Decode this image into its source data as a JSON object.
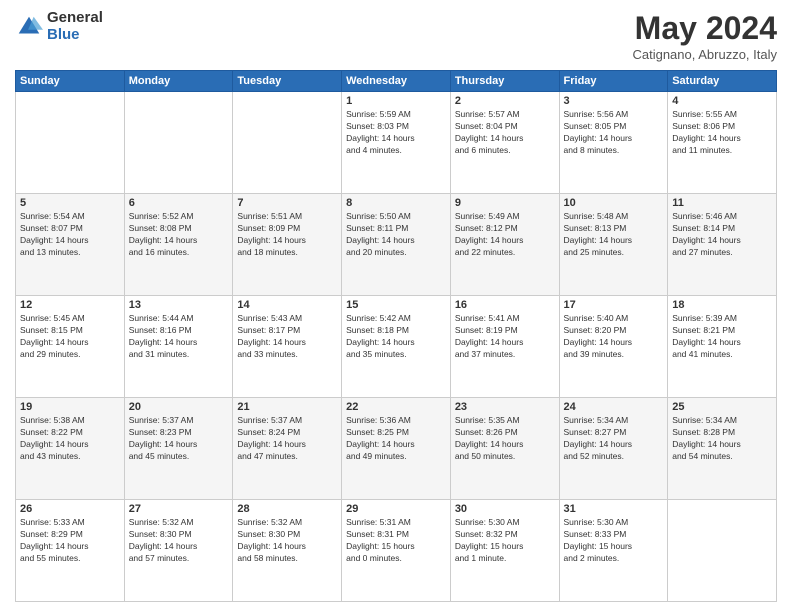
{
  "logo": {
    "general": "General",
    "blue": "Blue"
  },
  "title": "May 2024",
  "location": "Catignano, Abruzzo, Italy",
  "days_of_week": [
    "Sunday",
    "Monday",
    "Tuesday",
    "Wednesday",
    "Thursday",
    "Friday",
    "Saturday"
  ],
  "weeks": [
    [
      {
        "day": "",
        "info": ""
      },
      {
        "day": "",
        "info": ""
      },
      {
        "day": "",
        "info": ""
      },
      {
        "day": "1",
        "info": "Sunrise: 5:59 AM\nSunset: 8:03 PM\nDaylight: 14 hours\nand 4 minutes."
      },
      {
        "day": "2",
        "info": "Sunrise: 5:57 AM\nSunset: 8:04 PM\nDaylight: 14 hours\nand 6 minutes."
      },
      {
        "day": "3",
        "info": "Sunrise: 5:56 AM\nSunset: 8:05 PM\nDaylight: 14 hours\nand 8 minutes."
      },
      {
        "day": "4",
        "info": "Sunrise: 5:55 AM\nSunset: 8:06 PM\nDaylight: 14 hours\nand 11 minutes."
      }
    ],
    [
      {
        "day": "5",
        "info": "Sunrise: 5:54 AM\nSunset: 8:07 PM\nDaylight: 14 hours\nand 13 minutes."
      },
      {
        "day": "6",
        "info": "Sunrise: 5:52 AM\nSunset: 8:08 PM\nDaylight: 14 hours\nand 16 minutes."
      },
      {
        "day": "7",
        "info": "Sunrise: 5:51 AM\nSunset: 8:09 PM\nDaylight: 14 hours\nand 18 minutes."
      },
      {
        "day": "8",
        "info": "Sunrise: 5:50 AM\nSunset: 8:11 PM\nDaylight: 14 hours\nand 20 minutes."
      },
      {
        "day": "9",
        "info": "Sunrise: 5:49 AM\nSunset: 8:12 PM\nDaylight: 14 hours\nand 22 minutes."
      },
      {
        "day": "10",
        "info": "Sunrise: 5:48 AM\nSunset: 8:13 PM\nDaylight: 14 hours\nand 25 minutes."
      },
      {
        "day": "11",
        "info": "Sunrise: 5:46 AM\nSunset: 8:14 PM\nDaylight: 14 hours\nand 27 minutes."
      }
    ],
    [
      {
        "day": "12",
        "info": "Sunrise: 5:45 AM\nSunset: 8:15 PM\nDaylight: 14 hours\nand 29 minutes."
      },
      {
        "day": "13",
        "info": "Sunrise: 5:44 AM\nSunset: 8:16 PM\nDaylight: 14 hours\nand 31 minutes."
      },
      {
        "day": "14",
        "info": "Sunrise: 5:43 AM\nSunset: 8:17 PM\nDaylight: 14 hours\nand 33 minutes."
      },
      {
        "day": "15",
        "info": "Sunrise: 5:42 AM\nSunset: 8:18 PM\nDaylight: 14 hours\nand 35 minutes."
      },
      {
        "day": "16",
        "info": "Sunrise: 5:41 AM\nSunset: 8:19 PM\nDaylight: 14 hours\nand 37 minutes."
      },
      {
        "day": "17",
        "info": "Sunrise: 5:40 AM\nSunset: 8:20 PM\nDaylight: 14 hours\nand 39 minutes."
      },
      {
        "day": "18",
        "info": "Sunrise: 5:39 AM\nSunset: 8:21 PM\nDaylight: 14 hours\nand 41 minutes."
      }
    ],
    [
      {
        "day": "19",
        "info": "Sunrise: 5:38 AM\nSunset: 8:22 PM\nDaylight: 14 hours\nand 43 minutes."
      },
      {
        "day": "20",
        "info": "Sunrise: 5:37 AM\nSunset: 8:23 PM\nDaylight: 14 hours\nand 45 minutes."
      },
      {
        "day": "21",
        "info": "Sunrise: 5:37 AM\nSunset: 8:24 PM\nDaylight: 14 hours\nand 47 minutes."
      },
      {
        "day": "22",
        "info": "Sunrise: 5:36 AM\nSunset: 8:25 PM\nDaylight: 14 hours\nand 49 minutes."
      },
      {
        "day": "23",
        "info": "Sunrise: 5:35 AM\nSunset: 8:26 PM\nDaylight: 14 hours\nand 50 minutes."
      },
      {
        "day": "24",
        "info": "Sunrise: 5:34 AM\nSunset: 8:27 PM\nDaylight: 14 hours\nand 52 minutes."
      },
      {
        "day": "25",
        "info": "Sunrise: 5:34 AM\nSunset: 8:28 PM\nDaylight: 14 hours\nand 54 minutes."
      }
    ],
    [
      {
        "day": "26",
        "info": "Sunrise: 5:33 AM\nSunset: 8:29 PM\nDaylight: 14 hours\nand 55 minutes."
      },
      {
        "day": "27",
        "info": "Sunrise: 5:32 AM\nSunset: 8:30 PM\nDaylight: 14 hours\nand 57 minutes."
      },
      {
        "day": "28",
        "info": "Sunrise: 5:32 AM\nSunset: 8:30 PM\nDaylight: 14 hours\nand 58 minutes."
      },
      {
        "day": "29",
        "info": "Sunrise: 5:31 AM\nSunset: 8:31 PM\nDaylight: 15 hours\nand 0 minutes."
      },
      {
        "day": "30",
        "info": "Sunrise: 5:30 AM\nSunset: 8:32 PM\nDaylight: 15 hours\nand 1 minute."
      },
      {
        "day": "31",
        "info": "Sunrise: 5:30 AM\nSunset: 8:33 PM\nDaylight: 15 hours\nand 2 minutes."
      },
      {
        "day": "",
        "info": ""
      }
    ]
  ]
}
